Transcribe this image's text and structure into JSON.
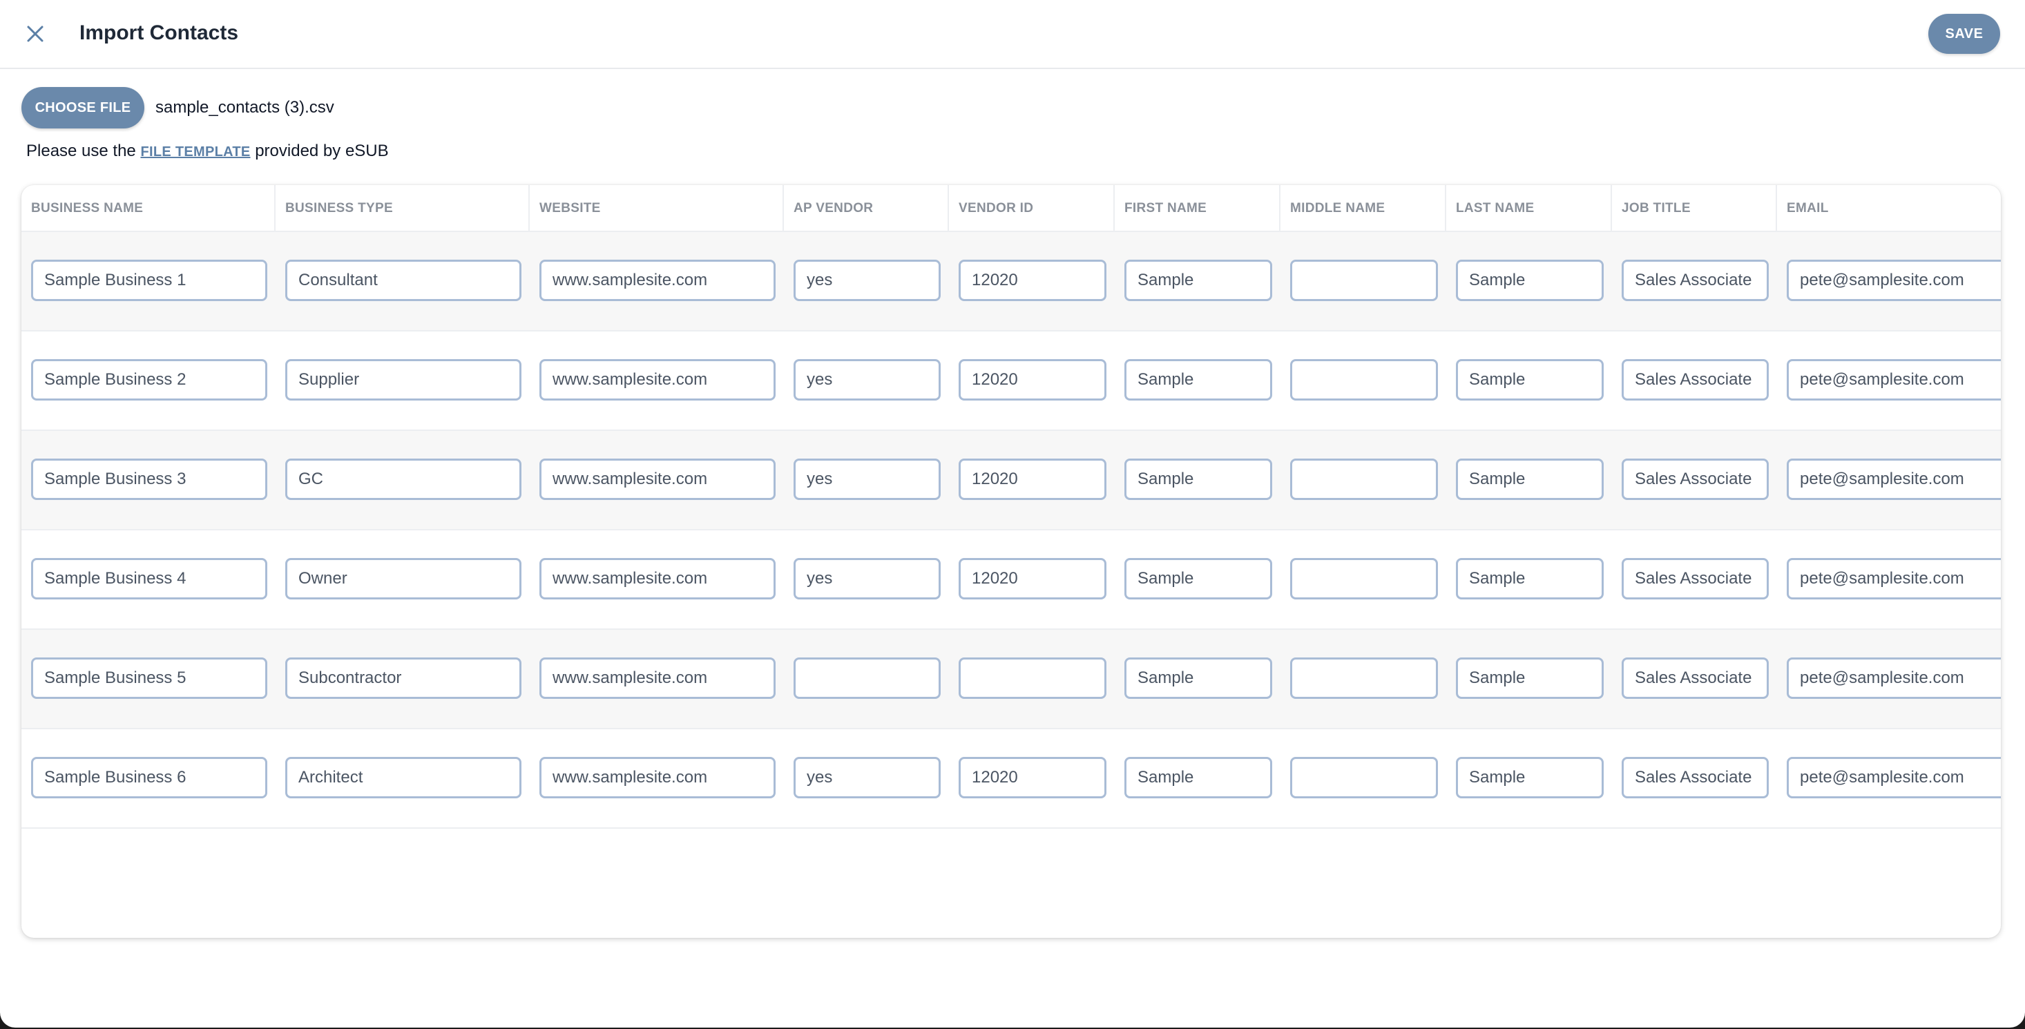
{
  "header": {
    "title": "Import Contacts",
    "save_label": "SAVE"
  },
  "file": {
    "choose_label": "CHOOSE FILE",
    "filename": "sample_contacts (3).csv"
  },
  "hint": {
    "prefix": "Please use the",
    "link_label": "FILE TEMPLATE",
    "suffix": "provided by eSUB"
  },
  "colors": {
    "accent": "#6a89ab",
    "input_border": "#a9bcd6",
    "link": "#5b7fa6"
  },
  "table": {
    "columns": [
      "BUSINESS NAME",
      "BUSINESS TYPE",
      "WEBSITE",
      "AP VENDOR",
      "VENDOR ID",
      "FIRST NAME",
      "MIDDLE NAME",
      "LAST NAME",
      "JOB TITLE",
      "EMAIL"
    ],
    "rows": [
      [
        "Sample Business 1",
        "Consultant",
        "www.samplesite.com",
        "yes",
        "12020",
        "Sample",
        "",
        "Sample",
        "Sales Associate",
        "pete@samplesite.com"
      ],
      [
        "Sample Business 2",
        "Supplier",
        "www.samplesite.com",
        "yes",
        "12020",
        "Sample",
        "",
        "Sample",
        "Sales Associate",
        "pete@samplesite.com"
      ],
      [
        "Sample Business 3",
        "GC",
        "www.samplesite.com",
        "yes",
        "12020",
        "Sample",
        "",
        "Sample",
        "Sales Associate",
        "pete@samplesite.com"
      ],
      [
        "Sample Business 4",
        "Owner",
        "www.samplesite.com",
        "yes",
        "12020",
        "Sample",
        "",
        "Sample",
        "Sales Associate",
        "pete@samplesite.com"
      ],
      [
        "Sample Business 5",
        "Subcontractor",
        "www.samplesite.com",
        "",
        "",
        "Sample",
        "",
        "Sample",
        "Sales Associate",
        "pete@samplesite.com"
      ],
      [
        "Sample Business 6",
        "Architect",
        "www.samplesite.com",
        "yes",
        "12020",
        "Sample",
        "",
        "Sample",
        "Sales Associate",
        "pete@samplesite.com"
      ]
    ]
  }
}
